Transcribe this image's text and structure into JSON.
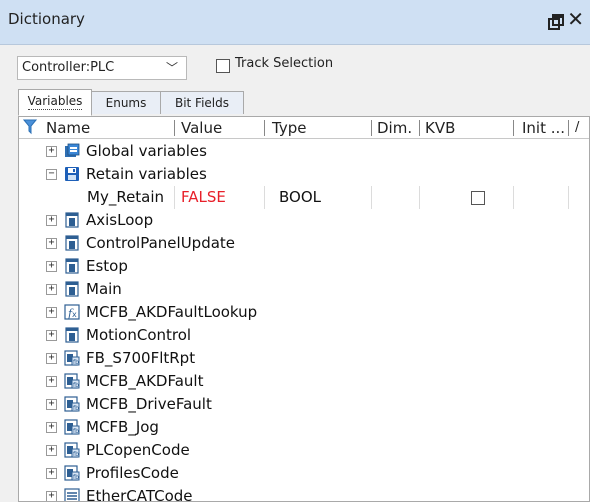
{
  "panel": {
    "title": "Dictionary"
  },
  "toolbar": {
    "controller_value": "Controller:PLC",
    "track_selection_label": "Track Selection",
    "track_selection_checked": false
  },
  "tabs": [
    {
      "label": "Variables",
      "active": true
    },
    {
      "label": "Enums",
      "active": false
    },
    {
      "label": "Bit Fields",
      "active": false
    }
  ],
  "columns": [
    {
      "label": "Name"
    },
    {
      "label": "Value"
    },
    {
      "label": "Type"
    },
    {
      "label": "Dim."
    },
    {
      "label": "KVB"
    },
    {
      "label": "Init ..."
    }
  ],
  "tree": [
    {
      "label": "Global variables",
      "expander": "+",
      "icon": "global-variables-icon"
    },
    {
      "label": "Retain variables",
      "expander": "−",
      "icon": "save-disk-icon"
    },
    {
      "label": "My_Retain",
      "value": "FALSE",
      "type": "BOOL",
      "kvb_checked": false
    },
    {
      "label": "AxisLoop",
      "expander": "+",
      "icon": "program-icon"
    },
    {
      "label": "ControlPanelUpdate",
      "expander": "+",
      "icon": "program-icon"
    },
    {
      "label": "Estop",
      "expander": "+",
      "icon": "program-icon"
    },
    {
      "label": "Main",
      "expander": "+",
      "icon": "program-icon"
    },
    {
      "label": "MCFB_AKDFaultLookup",
      "expander": "+",
      "icon": "function-icon"
    },
    {
      "label": "MotionControl",
      "expander": "+",
      "icon": "program-icon"
    },
    {
      "label": "FB_S700FltRpt",
      "expander": "+",
      "icon": "function-block-icon"
    },
    {
      "label": "MCFB_AKDFault",
      "expander": "+",
      "icon": "function-block-icon"
    },
    {
      "label": "MCFB_DriveFault",
      "expander": "+",
      "icon": "function-block-icon"
    },
    {
      "label": "MCFB_Jog",
      "expander": "+",
      "icon": "function-block-icon"
    },
    {
      "label": "PLCopenCode",
      "expander": "+",
      "icon": "function-block-icon"
    },
    {
      "label": "ProfilesCode",
      "expander": "+",
      "icon": "function-block-icon"
    },
    {
      "label": "EtherCATCode",
      "expander": "+",
      "icon": "ethercat-icon"
    }
  ]
}
